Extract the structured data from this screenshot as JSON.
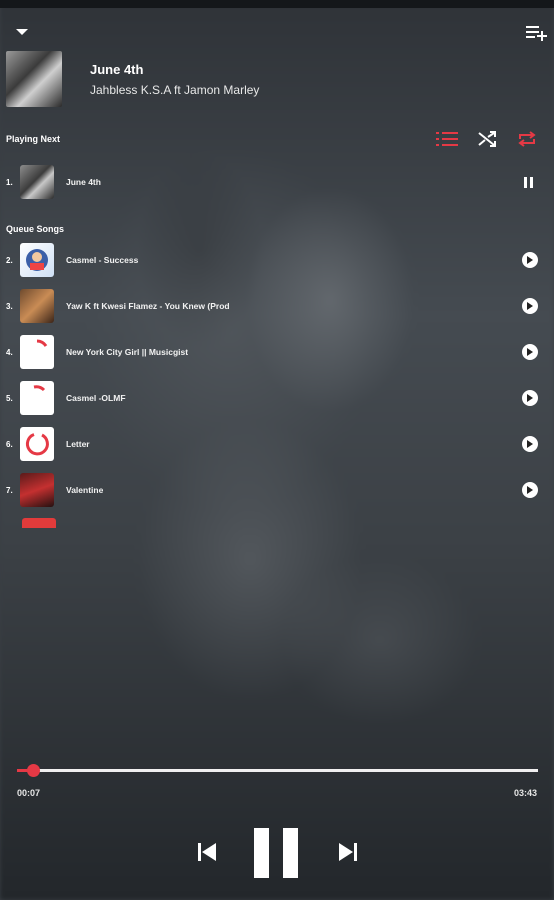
{
  "now_playing": {
    "title": "June 4th",
    "artist": "Jahbless K.S.A ft Jamon Marley"
  },
  "sections": {
    "playing_next": "Playing Next",
    "queue_songs": "Queue Songs"
  },
  "playing_next_track": {
    "number": "1.",
    "title": "June 4th"
  },
  "queue": [
    {
      "number": "2.",
      "title": "Casmel - Success"
    },
    {
      "number": "3.",
      "title": "Yaw K ft Kwesi Flamez - You Knew (Prod"
    },
    {
      "number": "4.",
      "title": "New York City Girl || Musicgist"
    },
    {
      "number": "5.",
      "title": "Casmel -OLMF"
    },
    {
      "number": "6.",
      "title": "Letter"
    },
    {
      "number": "7.",
      "title": "Valentine"
    }
  ],
  "progress": {
    "elapsed": "00:07",
    "total": "03:43",
    "fraction": 0.031
  },
  "colors": {
    "accent": "#e53945"
  }
}
